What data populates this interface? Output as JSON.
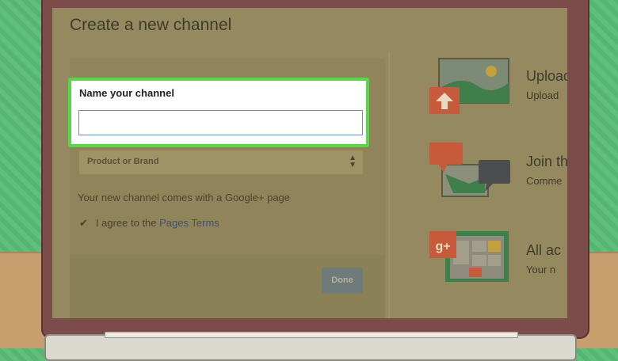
{
  "dialog": {
    "title": "Create a new channel",
    "name_label": "Name your channel",
    "name_value": "",
    "category_selected": "Product or Brand",
    "info_text": "Your new channel comes with a Google+ page",
    "agree_prefix": "I agree to the ",
    "agree_link": "Pages Terms",
    "done_label": "Done"
  },
  "features": [
    {
      "title": "Upload",
      "subtitle": "Upload",
      "icon": "upload-icon"
    },
    {
      "title": "Join th",
      "subtitle": "Comme",
      "icon": "comments-map-icon"
    },
    {
      "title": "All ac",
      "subtitle": "Your n",
      "icon": "google-plus-page-icon"
    }
  ],
  "colors": {
    "highlight_border": "#56d84a",
    "input_border": "#6e8ec8",
    "link": "#41516e",
    "done_button": "#6f7b7a",
    "gplus_red": "#c65a3a"
  }
}
